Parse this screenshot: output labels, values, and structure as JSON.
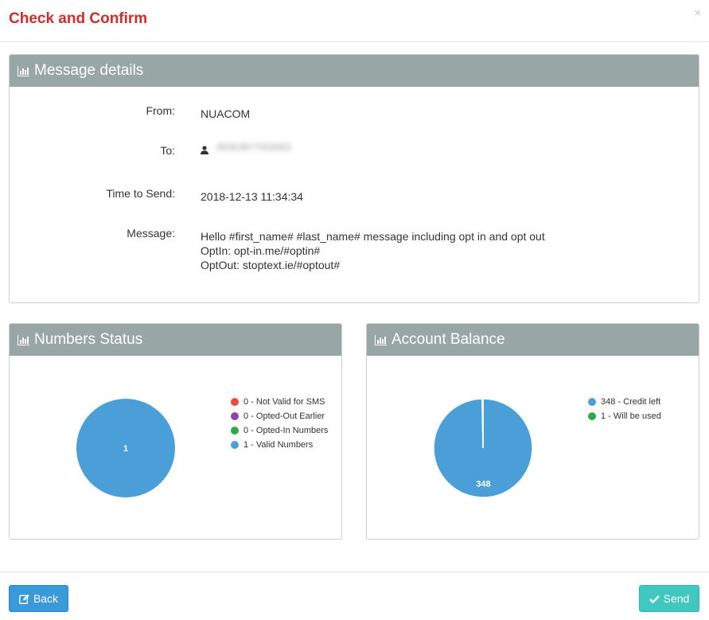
{
  "modal": {
    "title": "Check and Confirm",
    "close_label": "×"
  },
  "details_panel": {
    "title": "Message details",
    "from_label": "From:",
    "from_value": "NUACOM",
    "to_label": "To:",
    "to_value": "00353877053063",
    "time_label": "Time to Send:",
    "time_value": "2018-12-13 11:34:34",
    "message_label": "Message:",
    "message_lines": [
      "Hello #first_name# #last_name#  message including opt in and opt out",
      "OptIn: opt-in.me/#optin#",
      "OptOut: stoptext.ie/#optout#"
    ]
  },
  "numbers_panel": {
    "title": "Numbers Status"
  },
  "balance_panel": {
    "title": "Account Balance"
  },
  "chart_data": [
    {
      "type": "pie",
      "categories": [
        "0 - Not Valid for SMS",
        "0 - Opted-Out Earlier",
        "0 - Opted-In Numbers",
        "1 - Valid Numbers"
      ],
      "values": [
        0,
        0,
        0,
        1
      ],
      "colors": [
        "#e74c3c",
        "#8e44ad",
        "#2eaa4a",
        "#4a9fd8"
      ],
      "slice_labels": [
        "",
        "",
        "",
        "1"
      ],
      "legend_position": "right"
    },
    {
      "type": "pie",
      "categories": [
        "348 - Credit left",
        "1 - Will be used"
      ],
      "values": [
        348,
        1
      ],
      "colors": [
        "#4a9fd8",
        "#2eaa4a"
      ],
      "slice_labels": [
        "348",
        ""
      ],
      "legend_position": "right"
    }
  ],
  "footer": {
    "back_label": "Back",
    "send_label": "Send"
  },
  "icons": {
    "panel_header": "bar-chart-icon",
    "to_recipient": "user-icon",
    "back": "edit-icon",
    "send": "check-icon"
  }
}
